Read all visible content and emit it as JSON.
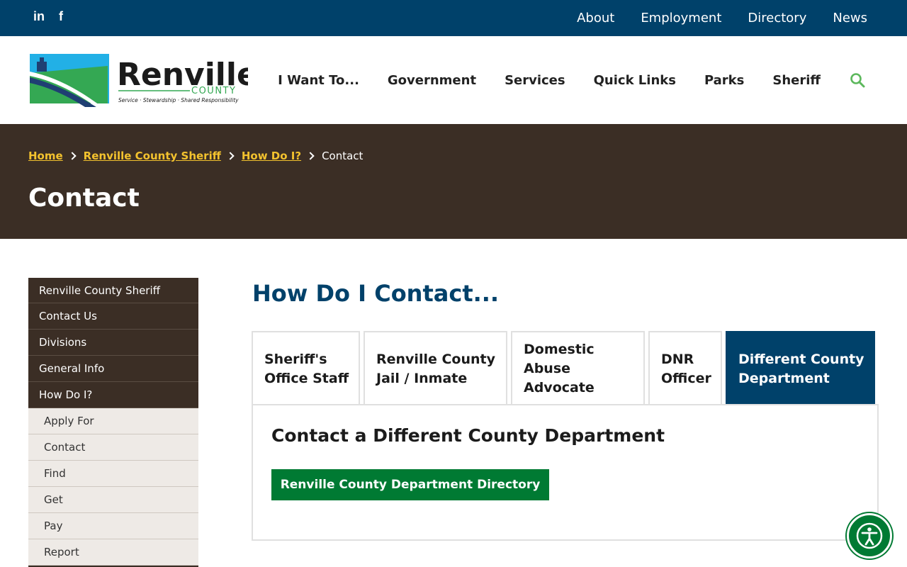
{
  "social": {
    "linkedin": "in",
    "facebook": "f"
  },
  "top_links": [
    "About",
    "Employment",
    "Directory",
    "News"
  ],
  "logo": {
    "name": "Renville",
    "county": "COUNTY",
    "tagline": "Service · Stewardship · Shared Responsibility"
  },
  "main_nav": [
    "I Want To...",
    "Government",
    "Services",
    "Quick Links",
    "Parks",
    "Sheriff"
  ],
  "breadcrumb": {
    "home": "Home",
    "sheriff": "Renville County Sheriff",
    "how": "How Do I?",
    "current": "Contact"
  },
  "page_title": "Contact",
  "sidebar": {
    "items": [
      "Renville County Sheriff",
      "Contact Us",
      "Divisions",
      "General Info",
      "How Do I?"
    ],
    "sub_items": [
      "Apply For",
      "Contact",
      "Find",
      "Get",
      "Pay",
      "Report"
    ]
  },
  "content": {
    "heading": "How Do I Contact...",
    "tabs": [
      {
        "line1": "Sheriff's",
        "line2": "Office Staff"
      },
      {
        "line1": "Renville County",
        "line2": "Jail / Inmate"
      },
      {
        "line1": "Domestic",
        "line2": "Abuse",
        "line3": "Advocate"
      },
      {
        "line1": "DNR",
        "line2": "Officer"
      },
      {
        "line1": "Different County",
        "line2": "Department"
      }
    ],
    "panel_title": "Contact a Different County Department",
    "button_label": "Renville County Department Directory"
  },
  "colors": {
    "navy": "#00416a",
    "brown": "#3b2e25",
    "gold": "#f3c22e",
    "green": "#007a33"
  }
}
